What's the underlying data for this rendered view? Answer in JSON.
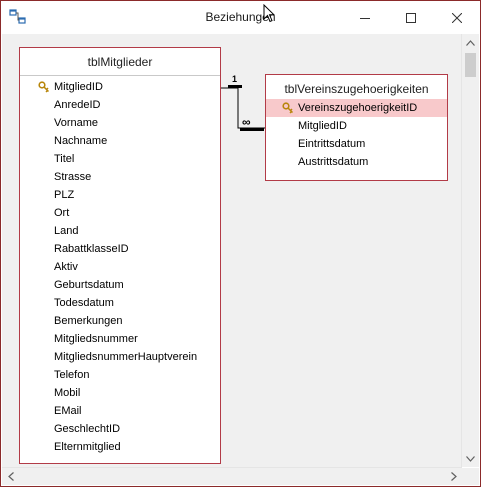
{
  "window": {
    "title": "Beziehungen",
    "app_icon": "relationships-icon",
    "buttons": [
      "minimize-icon",
      "maximize-icon",
      "close-icon"
    ]
  },
  "tables": [
    {
      "name": "tblMitglieder",
      "primary_key": "MitgliedID",
      "fields": [
        "MitgliedID",
        "AnredeID",
        "Vorname",
        "Nachname",
        "Titel",
        "Strasse",
        "PLZ",
        "Ort",
        "Land",
        "RabattklasseID",
        "Aktiv",
        "Geburtsdatum",
        "Todesdatum",
        "Bemerkungen",
        "Mitgliedsnummer",
        "MitgliedsnummerHauptverein",
        "Telefon",
        "Mobil",
        "EMail",
        "GeschlechtID",
        "Elternmitglied"
      ]
    },
    {
      "name": "tblVereinszugehoerigkeiten",
      "primary_key": "VereinszugehoerigkeitID",
      "selected_field": "VereinszugehoerigkeitID",
      "fields": [
        "VereinszugehoerigkeitID",
        "MitgliedID",
        "Eintrittsdatum",
        "Austrittsdatum"
      ]
    }
  ],
  "relationship": {
    "one_side_label": "1",
    "many_side_label": "∞",
    "from": "tblMitglieder.MitgliedID",
    "to": "tblVereinszugehoerigkeiten.MitgliedID"
  },
  "colors": {
    "window_border": "#8b2a2a",
    "table_border": "#b23b47",
    "selected_row": "#f8c9cb",
    "canvas": "#f0f0f0"
  }
}
